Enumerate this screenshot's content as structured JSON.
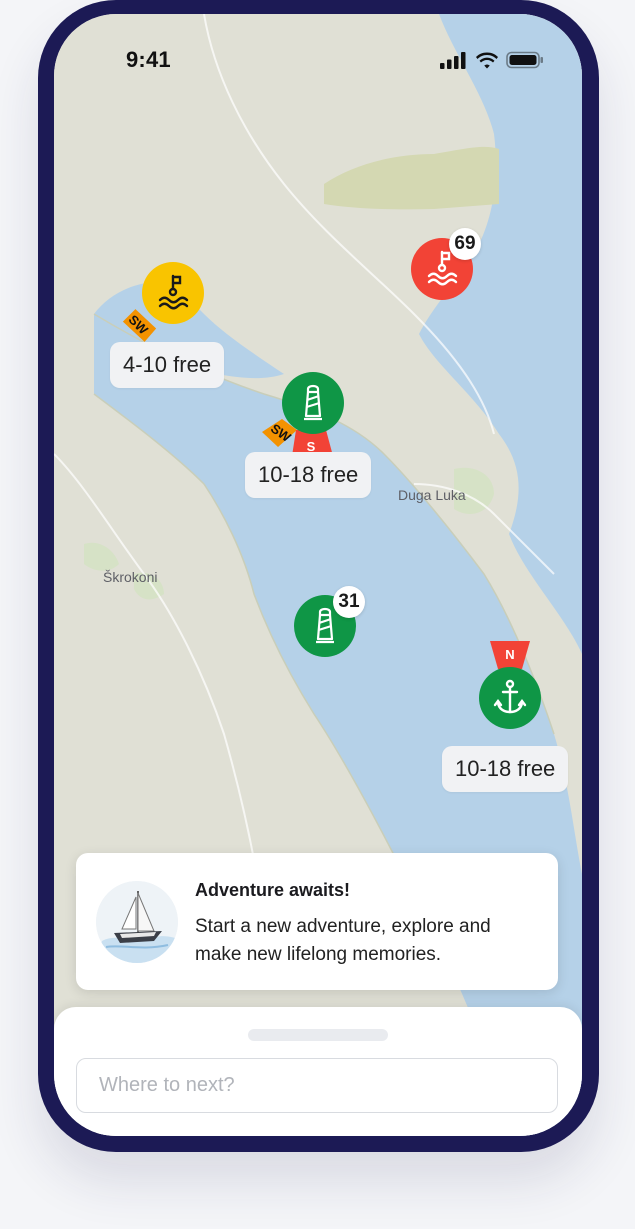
{
  "status_bar": {
    "time": "9:41"
  },
  "map": {
    "place_labels": [
      {
        "id": "duga-luka",
        "text": "Duga Luka"
      },
      {
        "id": "skrokoni",
        "text": "Škrokoni"
      }
    ],
    "markers": [
      {
        "id": "mooring-yellow",
        "icon": "mooring-buoy-icon",
        "color": "#f9c400",
        "wind": [
          "SW"
        ],
        "availability": "4-10 free"
      },
      {
        "id": "mooring-red",
        "icon": "mooring-buoy-icon",
        "color": "#f24336",
        "count": "69"
      },
      {
        "id": "marina-green",
        "icon": "marina-lighthouse-icon",
        "color": "#0f9646",
        "wind": [
          "SW",
          "S"
        ],
        "availability": "10-18 free"
      },
      {
        "id": "marina-green-2",
        "icon": "marina-lighthouse-icon",
        "color": "#0f9646",
        "count": "31"
      },
      {
        "id": "anchorage-green",
        "icon": "anchor-icon",
        "color": "#0f9646",
        "wind": [
          "N"
        ],
        "availability": "10-18 free"
      }
    ],
    "wind_colors": {
      "SW": "#f39200",
      "S": "#f24336",
      "N": "#f24336"
    }
  },
  "promo_card": {
    "title": "Adventure awaits!",
    "text": "Start a new adventure, explore and make new lifelong memories.",
    "image": "sailboat-illustration"
  },
  "bottom_sheet": {
    "search_placeholder": "Where to next?",
    "search_value": ""
  }
}
